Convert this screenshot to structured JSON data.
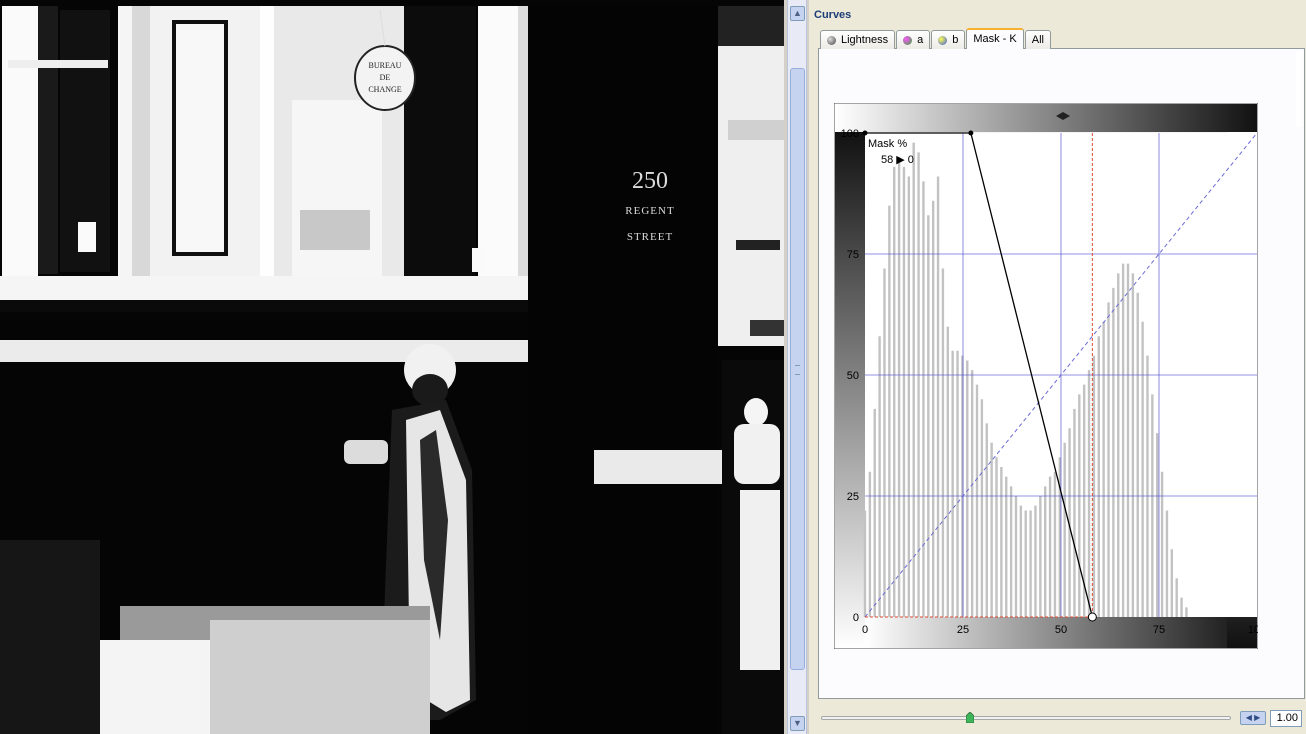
{
  "panel": {
    "title": "Curves",
    "tabs": [
      {
        "label": "Lightness",
        "icon": "lightness-channel-icon",
        "active": false
      },
      {
        "label": "a",
        "icon": "a-channel-icon",
        "active": false
      },
      {
        "label": "b",
        "icon": "b-channel-icon",
        "active": false
      },
      {
        "label": "Mask - K",
        "icon": "",
        "active": true
      },
      {
        "label": "All",
        "icon": "",
        "active": false
      }
    ]
  },
  "image": {
    "sign_lines": [
      "BUREAU",
      "DE",
      "CHANGE"
    ],
    "address_lines": [
      "250",
      "REGENT",
      "STREET"
    ]
  },
  "graph": {
    "channel_label": "Mask %",
    "readout": "58 ▶ 0",
    "ticks": [
      "0",
      "25",
      "50",
      "75",
      "100"
    ],
    "curve_points": [
      [
        0,
        100
      ],
      [
        27,
        100
      ],
      [
        58,
        0
      ]
    ],
    "selected_point": [
      58,
      0
    ],
    "grid": true,
    "diagonal_reference": true,
    "histogram": [
      22,
      30,
      43,
      58,
      72,
      85,
      93,
      95,
      93,
      91,
      98,
      96,
      90,
      83,
      86,
      91,
      72,
      60,
      55,
      55,
      54,
      53,
      51,
      48,
      45,
      40,
      36,
      33,
      31,
      29,
      27,
      25,
      23,
      22,
      22,
      23,
      25,
      27,
      29,
      30,
      33,
      36,
      39,
      43,
      46,
      48,
      51,
      54,
      58,
      61,
      65,
      68,
      71,
      73,
      73,
      71,
      67,
      61,
      54,
      46,
      38,
      30,
      22,
      14,
      8,
      4,
      2
    ]
  },
  "bottom": {
    "gamma_value": "1.00",
    "slider_position": 0.36
  },
  "colors": {
    "grid": "#4a4ad0",
    "histogram": "#c2c2c2",
    "curve": "#000000",
    "marker": "#e04a32",
    "tab_highlight": "#f7b131"
  }
}
